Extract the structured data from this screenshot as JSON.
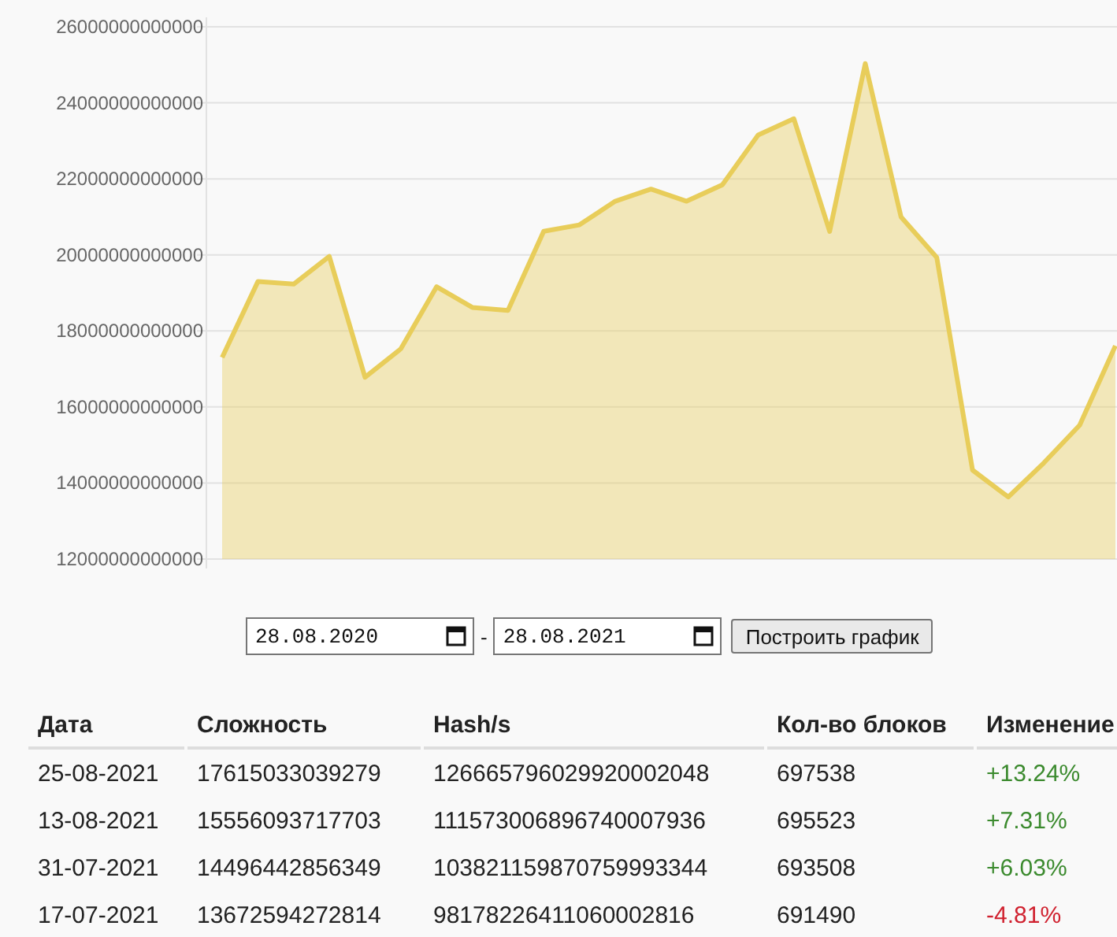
{
  "chart_data": {
    "type": "area",
    "values": [
      17300000000000,
      19300000000000,
      19230000000000,
      19960000000000,
      16780000000000,
      17530000000000,
      19160000000000,
      18620000000000,
      18540000000000,
      20620000000000,
      20790000000000,
      21410000000000,
      21730000000000,
      21410000000000,
      21840000000000,
      23150000000000,
      23580000000000,
      20620000000000,
      25030000000000,
      21000000000000,
      19930000000000,
      14340000000000,
      13630000000000,
      14530000000000,
      15520000000000,
      17610000000000
    ],
    "ylim": [
      12000000000000,
      26000000000000
    ],
    "grid": true,
    "yticks": [
      {
        "value": 12000000000000,
        "label": "12000000000000"
      },
      {
        "value": 14000000000000,
        "label": "14000000000000"
      },
      {
        "value": 16000000000000,
        "label": "16000000000000"
      },
      {
        "value": 18000000000000,
        "label": "18000000000000"
      },
      {
        "value": 20000000000000,
        "label": "20000000000000"
      },
      {
        "value": 22000000000000,
        "label": "22000000000000"
      },
      {
        "value": 24000000000000,
        "label": "24000000000000"
      },
      {
        "value": 26000000000000,
        "label": "26000000000000"
      }
    ]
  },
  "date_range": {
    "from": "28.08.2020",
    "separator": "-",
    "to": "28.08.2021",
    "button": "Построить график"
  },
  "table": {
    "columns": [
      "Дата",
      "Сложность",
      "Hash/s",
      "Кол-во блоков",
      "Изменение"
    ],
    "rows": [
      {
        "date": "25-08-2021",
        "difficulty": "17615033039279",
        "hashrate": "126665796029920002048",
        "blocks": "697538",
        "change": "+13.24%",
        "color": "#3b8a2e"
      },
      {
        "date": "13-08-2021",
        "difficulty": "15556093717703",
        "hashrate": "111573006896740007936",
        "blocks": "695523",
        "change": "+7.31%",
        "color": "#3b8a2e"
      },
      {
        "date": "31-07-2021",
        "difficulty": "14496442856349",
        "hashrate": "103821159870759993344",
        "blocks": "693508",
        "change": "+6.03%",
        "color": "#3b8a2e"
      },
      {
        "date": "17-07-2021",
        "difficulty": "13672594272814",
        "hashrate": "98178226411060002816",
        "blocks": "691490",
        "change": "-4.81%",
        "color": "#d0212f"
      }
    ]
  }
}
